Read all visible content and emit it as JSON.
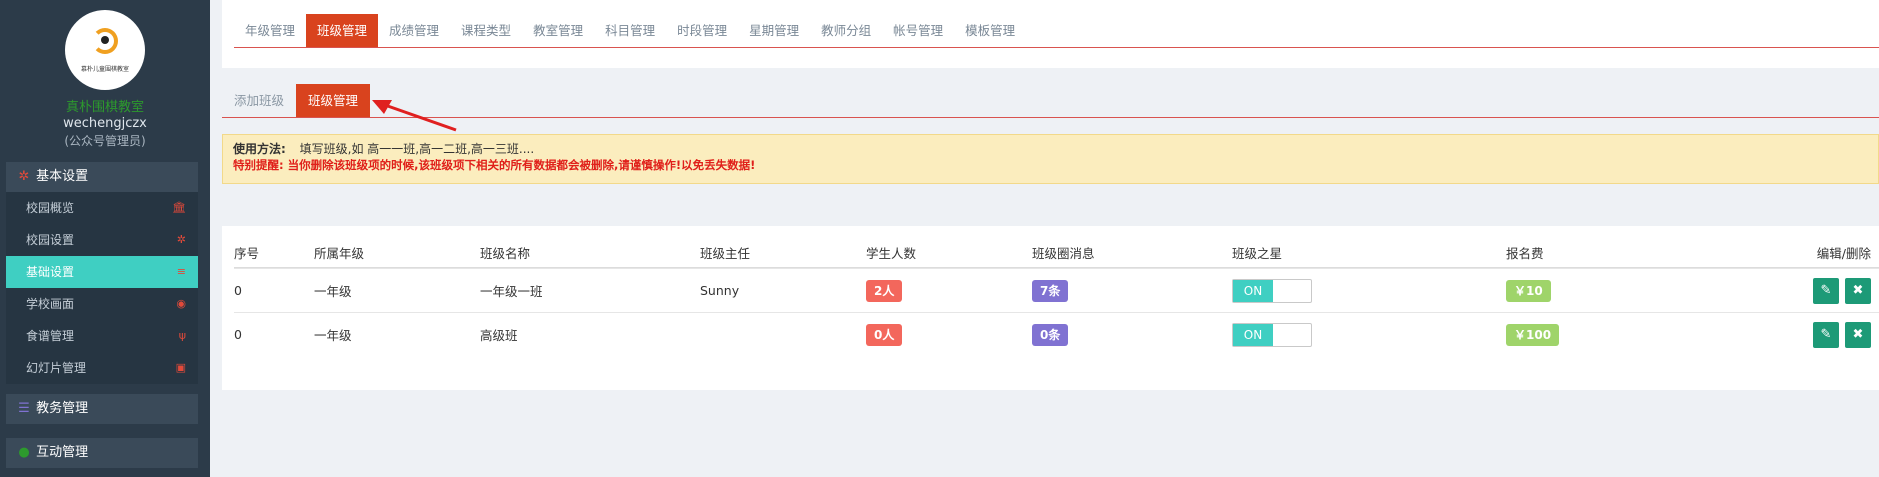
{
  "sidebar": {
    "logo_text": "慕朴儿童围棋教室",
    "school_name": "真朴围棋教室",
    "account": "wechengjczx",
    "role": "(公众号管理员)",
    "groups": [
      {
        "label": "基本设置",
        "icon": "gear-icon"
      },
      {
        "label": "教务管理",
        "icon": "database-icon"
      },
      {
        "label": "互动管理",
        "icon": "chat-icon"
      }
    ],
    "items": [
      {
        "label": "校园概览",
        "icon": "bank-icon",
        "glyph": "🏛"
      },
      {
        "label": "校园设置",
        "icon": "gear-icon",
        "glyph": "✲"
      },
      {
        "label": "基础设置",
        "icon": "list-icon",
        "glyph": "≡"
      },
      {
        "label": "学校画面",
        "icon": "eye-icon",
        "glyph": "◉"
      },
      {
        "label": "食谱管理",
        "icon": "cutlery-icon",
        "glyph": "ψ"
      },
      {
        "label": "幻灯片管理",
        "icon": "image-icon",
        "glyph": "▣"
      }
    ]
  },
  "top_tabs": [
    "年级管理",
    "班级管理",
    "成绩管理",
    "课程类型",
    "教室管理",
    "科目管理",
    "时段管理",
    "星期管理",
    "教师分组",
    "帐号管理",
    "模板管理"
  ],
  "sub_tabs": [
    "添加班级",
    "班级管理"
  ],
  "notice": {
    "usage_label": "使用方法:",
    "usage_text": "填写班级,如 高一一班,高一二班,高一三班....",
    "warning": "特别提醒: 当你删除该班级项的时候,该班级项下相关的所有数据都会被删除,请谨慎操作!以免丢失数据!"
  },
  "table": {
    "headers": [
      "序号",
      "所属年级",
      "班级名称",
      "班级主任",
      "学生人数",
      "班级圈消息",
      "班级之星",
      "报名费",
      "编辑/删除"
    ],
    "rows": [
      {
        "no": "0",
        "grade": "一年级",
        "class": "一年级一班",
        "teacher": "Sunny",
        "students": "2人",
        "messages": "7条",
        "star": "ON",
        "fee": "￥10"
      },
      {
        "no": "0",
        "grade": "一年级",
        "class": "高级班",
        "teacher": "",
        "students": "0人",
        "messages": "0条",
        "star": "ON",
        "fee": "￥100"
      }
    ]
  }
}
